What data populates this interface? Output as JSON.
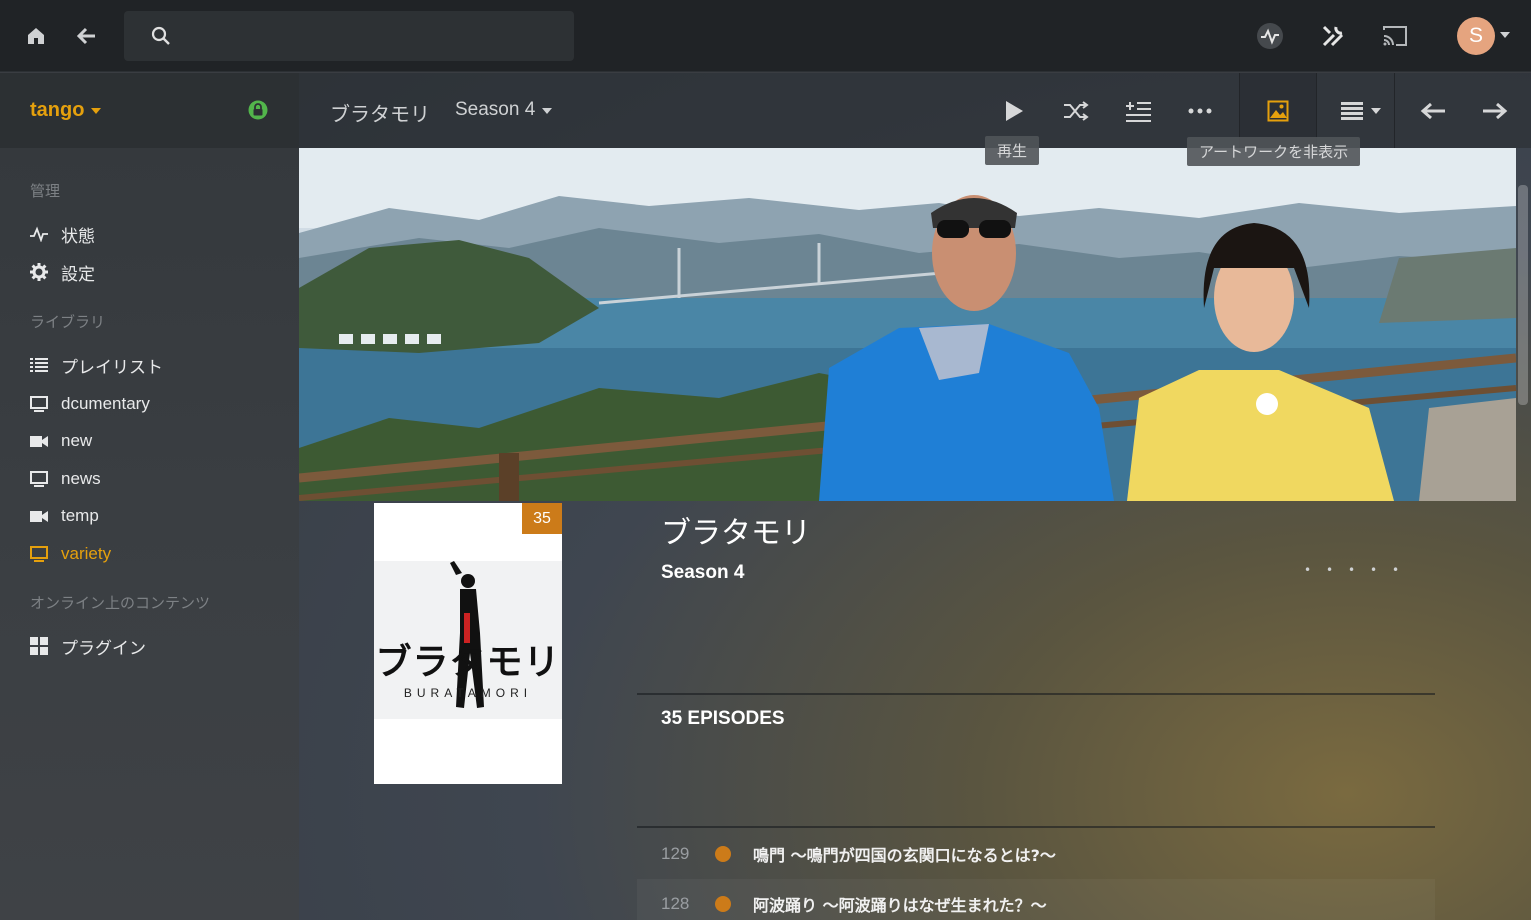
{
  "topbar": {
    "search_placeholder": "",
    "avatar_letter": "S",
    "icons": [
      "home-icon",
      "back-arrow-icon",
      "search-icon",
      "activity-icon",
      "tools-icon",
      "cast-icon"
    ]
  },
  "sidebar": {
    "server_name": "tango",
    "sections": {
      "manage": "管理",
      "library": "ライブラリ",
      "online": "オンライン上のコンテンツ"
    },
    "manage_items": [
      {
        "label": "状態",
        "icon": "activity-icon"
      },
      {
        "label": "設定",
        "icon": "gear-icon"
      }
    ],
    "library_items": [
      {
        "label": "プレイリスト",
        "icon": "list-icon"
      },
      {
        "label": "dcumentary",
        "icon": "tv-icon"
      },
      {
        "label": "new",
        "icon": "video-camera-icon"
      },
      {
        "label": "news",
        "icon": "tv-icon"
      },
      {
        "label": "temp",
        "icon": "video-camera-icon"
      },
      {
        "label": "variety",
        "icon": "tv-icon",
        "active": true
      }
    ],
    "online_items": [
      {
        "label": "プラグイン",
        "icon": "grid-icon"
      }
    ]
  },
  "header": {
    "breadcrumb_title": "ブラタモリ",
    "breadcrumb_season": "Season 4",
    "tooltip_play": "再生",
    "tooltip_artwork": "アートワークを非表示"
  },
  "details": {
    "poster_badge": "35",
    "poster_logo_text": "ブラタモリ",
    "poster_logo_sub": "BURATAMORI",
    "title": "ブラタモリ",
    "season": "Season 4",
    "episodes_heading": "35 EPISODES",
    "episodes": [
      {
        "number": "129",
        "title": "鳴門 ～鳴門が四国の玄関口になるとは?～"
      },
      {
        "number": "128",
        "title": "阿波踊り ～阿波踊りはなぜ生まれた？～"
      }
    ]
  },
  "colors": {
    "accent": "#e5a00d",
    "topbar_bg": "#202326",
    "badge": "#cc7b19",
    "avatar": "#e5a47f",
    "lock": "#52b54b"
  }
}
